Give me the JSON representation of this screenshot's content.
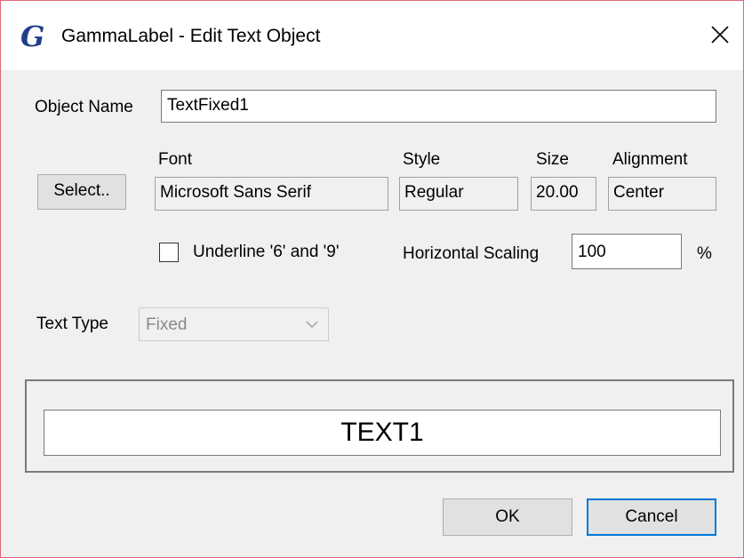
{
  "window": {
    "title": "GammaLabel - Edit Text Object",
    "icon_letter": "G",
    "close_glyph": "close-icon"
  },
  "object_name": {
    "label": "Object Name",
    "value": "TextFixed1"
  },
  "font_section": {
    "select_button": "Select..",
    "font_label": "Font",
    "font_value": "Microsoft Sans Serif",
    "style_label": "Style",
    "style_value": "Regular",
    "size_label": "Size",
    "size_value": "20.00",
    "alignment_label": "Alignment",
    "alignment_value": "Center"
  },
  "options": {
    "underline_label": "Underline '6' and '9'",
    "underline_checked": false,
    "hscale_label": "Horizontal Scaling",
    "hscale_value": "100",
    "hscale_unit": "%"
  },
  "text_type": {
    "label": "Text Type",
    "selected": "Fixed",
    "enabled": false
  },
  "preview": {
    "text": "TEXT1"
  },
  "buttons": {
    "ok": "OK",
    "cancel": "Cancel"
  },
  "colors": {
    "window_border": "#e0667a",
    "icon": "#1f3f8a",
    "default_button_border": "#0078d7"
  }
}
